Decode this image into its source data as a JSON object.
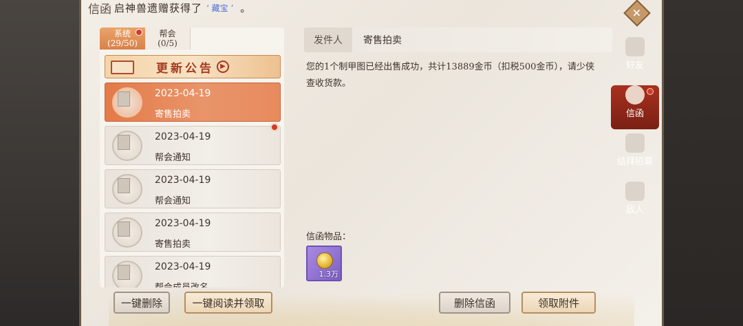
{
  "marquee": {
    "title_char": "信函",
    "text": "启神兽遗赠获得了",
    "item": "‘ 藏宝 ’",
    "end": "。"
  },
  "close": {
    "icon": "close-icon"
  },
  "tabs": [
    {
      "label": "系统",
      "count": "(29/50)"
    },
    {
      "label": "帮会",
      "count": "(0/5)"
    }
  ],
  "announcement": {
    "label": "更新公告"
  },
  "mails": [
    {
      "date": "2023-04-19",
      "type": "寄售拍卖"
    },
    {
      "date": "2023-04-19",
      "type": "帮会通知"
    },
    {
      "date": "2023-04-19",
      "type": "帮会通知"
    },
    {
      "date": "2023-04-19",
      "type": "寄售拍卖"
    },
    {
      "date": "2023-04-19",
      "type": "帮会成员改名"
    }
  ],
  "bottom_left": {
    "delete_all": "一键删除",
    "read_all": "一键阅读并领取"
  },
  "detail": {
    "sender_label": "发件人",
    "sender_name": "寄售拍卖",
    "body": "您的1个制甲图已经出售成功，共计13889金币（扣税500金币），请少侠查收货款。",
    "items_label": "信函物品：",
    "item_count": "1.3万"
  },
  "bottom_right": {
    "delete_mail": "删除信函",
    "claim": "领取附件"
  },
  "sidebar": [
    {
      "label": "好友",
      "icon": "friends-icon"
    },
    {
      "label": "信函",
      "icon": "mail-icon"
    },
    {
      "label": "结拜招募",
      "icon": "recruit-icon"
    },
    {
      "label": "敌人",
      "icon": "enemy-icon"
    }
  ]
}
